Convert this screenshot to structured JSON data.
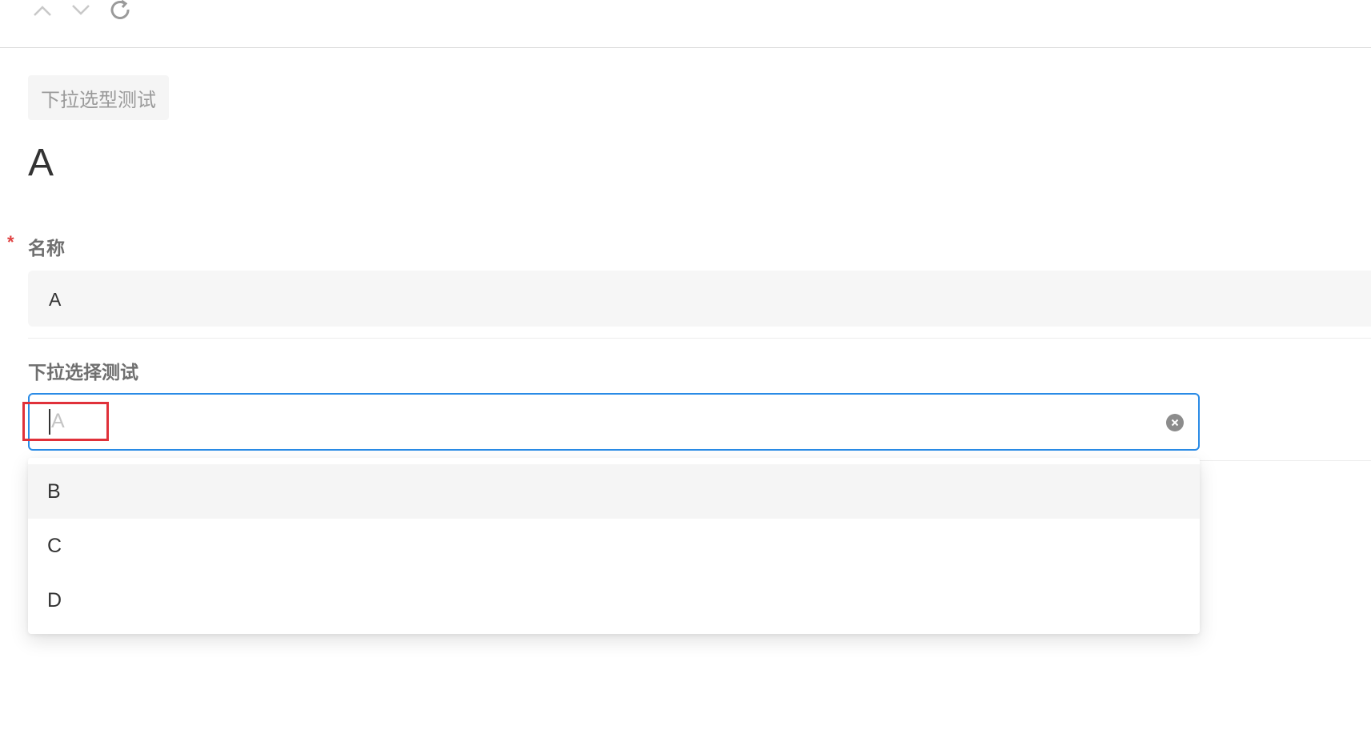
{
  "toolbar": {
    "prev_icon": "chevron-up-icon",
    "next_icon": "chevron-down-icon",
    "refresh_icon": "refresh-icon"
  },
  "record": {
    "tag": "下拉选型测试",
    "title": "A"
  },
  "fields": {
    "name": {
      "label": "名称",
      "required_mark": "*",
      "value": "A"
    },
    "dropdown_test": {
      "label": "下拉选择测试",
      "current_value": "A",
      "clear_icon": "clear-circle-icon",
      "options": [
        {
          "label": "B",
          "highlighted": true
        },
        {
          "label": "C",
          "highlighted": false
        },
        {
          "label": "D",
          "highlighted": false
        }
      ]
    }
  },
  "colors": {
    "focus_border": "#2a8be6",
    "required": "#e04343",
    "annotation": "#e0313a"
  }
}
